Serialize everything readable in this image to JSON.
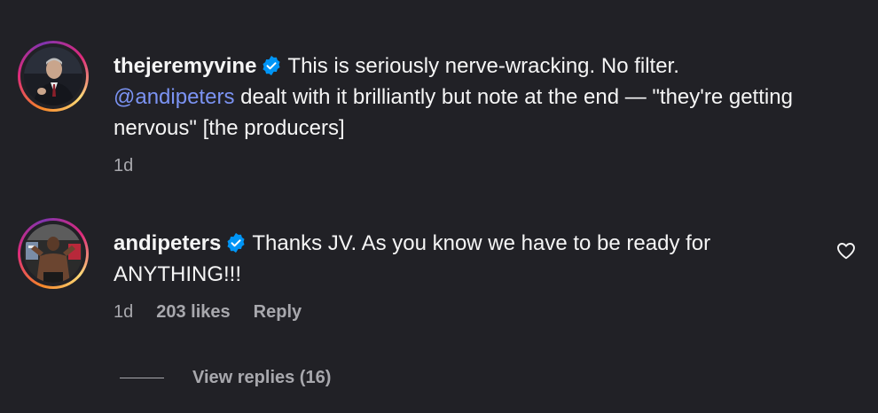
{
  "colors": {
    "background": "#212126",
    "text": "#f5f5f5",
    "muted": "#a8a8ad",
    "mention": "#7b93f3",
    "verified": "#0095f6"
  },
  "comments": [
    {
      "username": "thejeremyvine",
      "verified_icon": "verified-badge-icon",
      "text_before_mention": "This is seriously nerve-wracking. No filter.",
      "mention": "@andipeters",
      "text_after_mention": "dealt with it brilliantly but note at the end — \"they're getting nervous\" [the producers]",
      "time": "1d"
    },
    {
      "username": "andipeters",
      "verified_icon": "verified-badge-icon",
      "text": "Thanks JV. As you know we have to be ready for ANYTHING!!!",
      "time": "1d",
      "likes": "203 likes",
      "reply_label": "Reply",
      "like_icon": "heart-outline-icon"
    }
  ],
  "view_replies": {
    "label": "View replies (16)"
  }
}
